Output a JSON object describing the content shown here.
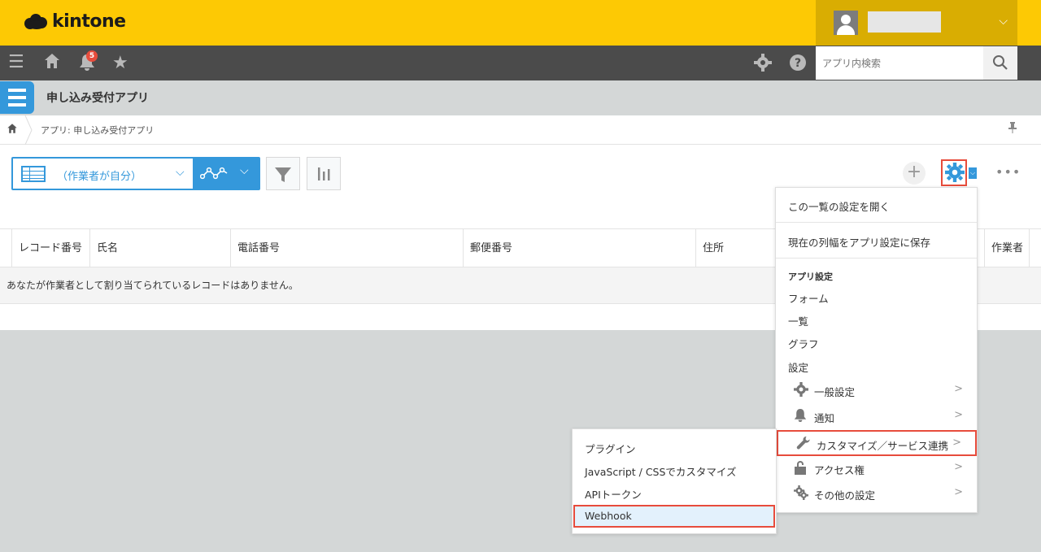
{
  "brand": {
    "name": "kintone"
  },
  "nav": {
    "notification_count": "5",
    "search_placeholder": "アプリ内検索"
  },
  "app": {
    "title": "申し込み受付アプリ"
  },
  "breadcrumb": {
    "path": "アプリ: 申し込み受付アプリ"
  },
  "view": {
    "selected": "（作業者が自分）"
  },
  "table": {
    "columns": [
      "レコード番号",
      "氏名",
      "電話番号",
      "郵便番号",
      "住所",
      "作業者"
    ],
    "empty_message": "あなたが作業者として割り当てられているレコードはありません。"
  },
  "settings_menu": {
    "open_view_settings": "この一覧の設定を開く",
    "save_column_width": "現在の列幅をアプリ設定に保存",
    "app_settings_header": "アプリ設定",
    "form": "フォーム",
    "views": "一覧",
    "graphs": "グラフ",
    "settings": "設定",
    "general": "一般設定",
    "notifications": "通知",
    "customize": "カスタマイズ／サービス連携",
    "access": "アクセス権",
    "other": "その他の設定"
  },
  "customize_submenu": {
    "plugins": "プラグイン",
    "js_css": "JavaScript / CSSでカスタマイズ",
    "api_token": "APIトークン",
    "webhook": "Webhook"
  },
  "colors": {
    "brand_yellow": "#fdc904",
    "nav_dark": "#4b4b4b",
    "accent_blue": "#3498db",
    "highlight_red": "#e74c3c"
  }
}
